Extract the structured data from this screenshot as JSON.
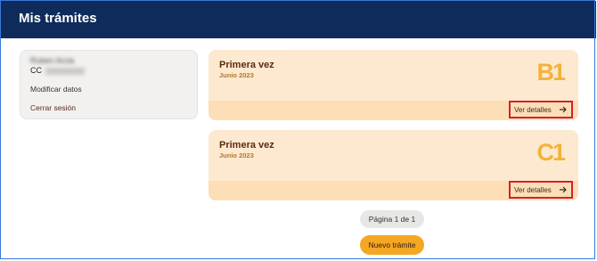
{
  "header": {
    "title": "Mis trámites"
  },
  "user": {
    "name": "Ruben Arcia",
    "doc_type": "CC",
    "modify_label": "Modificar datos",
    "logout_label": "Cerrar sesión"
  },
  "procedures": [
    {
      "title": "Primera vez",
      "date": "Junio 2023",
      "level": "B1",
      "details_label": "Ver detalles"
    },
    {
      "title": "Primera vez",
      "date": "Junio 2023",
      "level": "C1",
      "details_label": "Ver detalles"
    }
  ],
  "pagination": {
    "label": "Página 1 de 1"
  },
  "actions": {
    "new_label": "Nuevo trámite"
  },
  "colors": {
    "header_bg": "#0e2b5c",
    "card_bg": "#fde9cf",
    "accent": "#f5a623",
    "level_badge": "#f3b23c",
    "highlight_border": "#d2222d"
  }
}
